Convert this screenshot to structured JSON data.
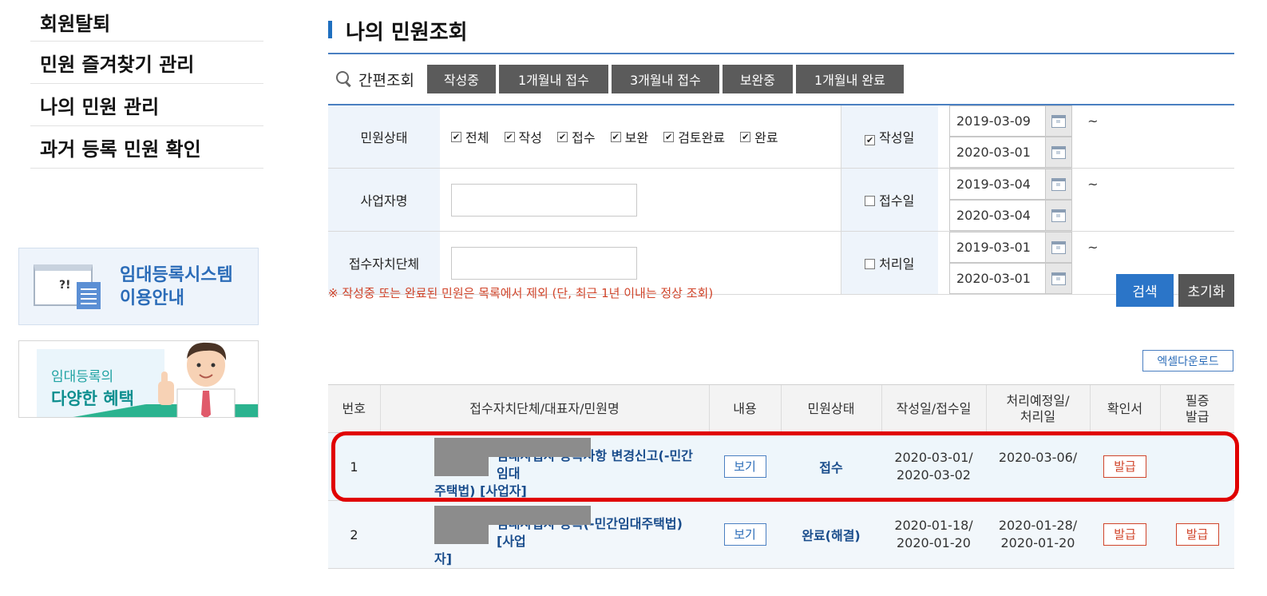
{
  "sidebar": {
    "items": [
      "회원탈퇴",
      "민원 즐겨찾기 관리",
      "나의 민원 관리",
      "과거 등록 민원 확인"
    ],
    "guide_banner": {
      "line1": "임대등록시스템",
      "line2": "이용안내"
    },
    "benefit_banner": {
      "line1": "임대등록의",
      "line2": "다양한 혜택"
    }
  },
  "page_title": "나의 민원조회",
  "quick_search": {
    "label": "간편조회",
    "buttons": [
      "작성중",
      "1개월내 접수",
      "3개월내 접수",
      "보완중",
      "1개월내 완료"
    ]
  },
  "filters": {
    "status_label": "민원상태",
    "status_options": [
      "전체",
      "작성",
      "접수",
      "보완",
      "검토완료",
      "완료"
    ],
    "business_name_label": "사업자명",
    "agency_label": "접수자치단체",
    "date_rows": [
      {
        "label": "작성일",
        "checked": true,
        "from": "2019-03-09",
        "to": "2020-03-01"
      },
      {
        "label": "접수일",
        "checked": false,
        "from": "2019-03-04",
        "to": "2020-03-04"
      },
      {
        "label": "처리일",
        "checked": false,
        "from": "2019-03-01",
        "to": "2020-03-01"
      }
    ],
    "tilde": "~"
  },
  "notice": "※ 작성중 또는 완료된 민원은 목록에서 제외 (단, 최근 1년 이내는 정상 조회)",
  "buttons": {
    "search": "검색",
    "reset": "초기화",
    "excel": "엑셀다운로드"
  },
  "result_table": {
    "headers": {
      "no": "번호",
      "name": "접수자치단체/대표자/민원명",
      "content": "내용",
      "status": "민원상태",
      "date1a": "작성일/접수일",
      "date2_l1": "처리예정일/",
      "date2_l2": "처리일",
      "confirm": "확인서",
      "cert_l1": "필증",
      "cert_l2": "발급"
    },
    "rows": [
      {
        "no": "1",
        "title_line1": "임대사업자 등록사항 변경신고(-민간임대",
        "title_line2": "주택법) [사업자]",
        "view": "보기",
        "status": "접수",
        "written": "2020-03-01/",
        "received": "2020-03-02",
        "planned": "2020-03-06/",
        "processed": "",
        "confirm": "발급",
        "cert": ""
      },
      {
        "no": "2",
        "title_line1": "임대사업자 등록(-민간임대주택법) [사업",
        "title_line2": "자]",
        "view": "보기",
        "status": "완료(해결)",
        "written": "2020-01-18/",
        "received": "2020-01-20",
        "planned": "2020-01-28/",
        "processed": "2020-01-20",
        "confirm": "발급",
        "cert": "발급"
      }
    ]
  },
  "colors": {
    "accent_blue": "#2b75c8",
    "notice_red": "#d0442a",
    "highlight_red": "#e00000"
  }
}
